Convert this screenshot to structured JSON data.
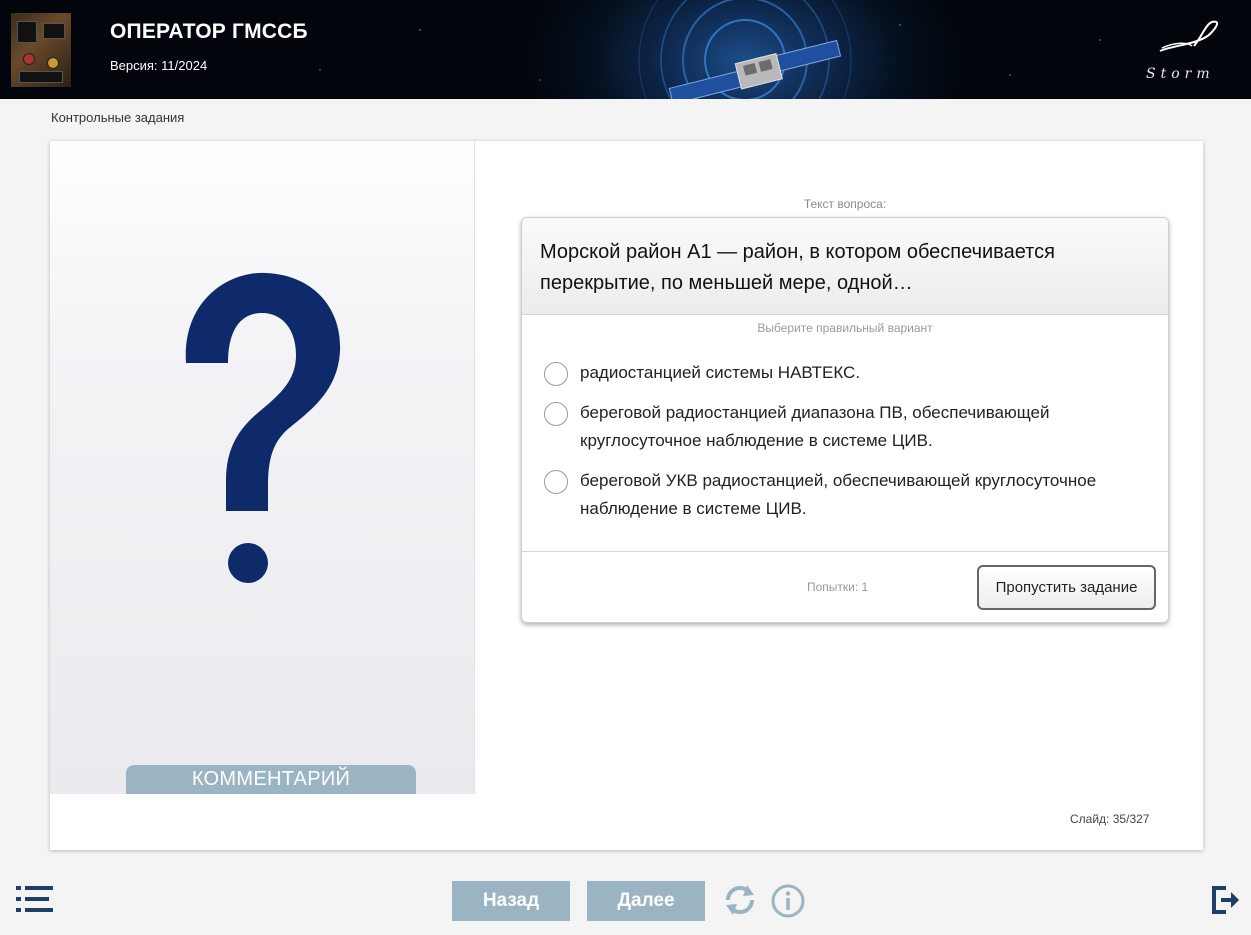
{
  "header": {
    "title": "ОПЕРАТОР ГМССБ",
    "version": "Версия: 11/2024",
    "logo_text": "Storm"
  },
  "breadcrumb": "Контрольные задания",
  "left_panel": {
    "placeholder_icon": "question-mark-icon",
    "comment_label": "КОММЕНТАРИЙ"
  },
  "question": {
    "caption": "Текст вопроса:",
    "text": "Морской район А1 — район, в котором обеспечивается перекрытие, по меньшей мере, одной…",
    "hint": "Выберите правильный вариант",
    "options": [
      {
        "label": "радиостанцией системы НАВТЕКС."
      },
      {
        "label": "береговой радиостанцией диапазона ПВ, обеспечивающей круглосуточное наблюдение в системе ЦИВ."
      },
      {
        "label": "береговой УКВ радиостанцией, обеспечивающей круглосуточное наблюдение в системе ЦИВ."
      }
    ],
    "attempts": "Попытки: 1",
    "skip_label": "Пропустить задание"
  },
  "slide": {
    "label": "Слайд:",
    "current": "35",
    "separator": "/",
    "total": "327"
  },
  "nav": {
    "back_label": "Назад",
    "next_label": "Далее",
    "icons": [
      "menu-list-icon",
      "reload-icon",
      "info-icon",
      "exit-icon"
    ]
  },
  "colors": {
    "accent": "#9bb4c4",
    "icon_dark": "#1b3f66",
    "question_mark": "#0e2a6b"
  }
}
